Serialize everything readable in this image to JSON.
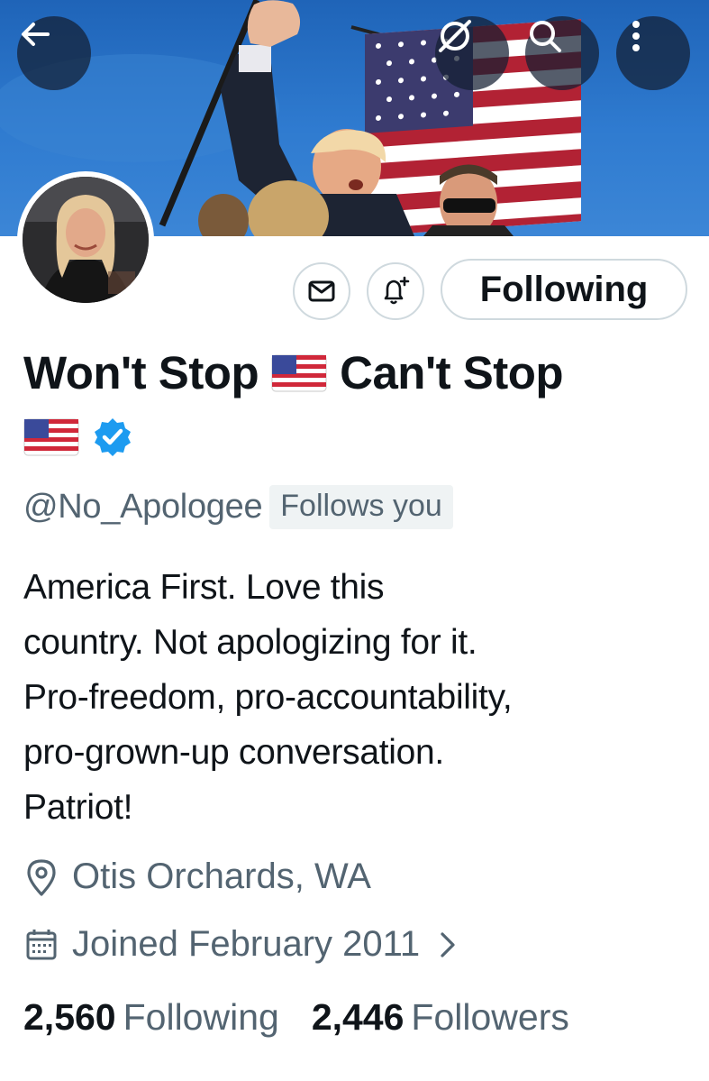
{
  "profile": {
    "name_part1": "Won't Stop",
    "name_part2": "Can't Stop",
    "name_flag_emoji": "us-flag",
    "verified": true,
    "verified_color": "#1d9bf0",
    "handle": "@No_Apologee",
    "follows_you_label": "Follows you",
    "bio_lines": [
      "America First. Love this",
      "country. Not apologizing for it.",
      "Pro-freedom, pro-accountability,",
      "pro-grown-up conversation.",
      "Patriot!"
    ],
    "location": "Otis Orchards, WA",
    "joined": "Joined February 2011",
    "following_count": "2,560",
    "following_label": "Following",
    "followers_count": "2,446",
    "followers_label": "Followers"
  },
  "actions": {
    "following_button_label": "Following",
    "message_icon": "mail-icon",
    "notify_icon": "bell-plus-icon"
  },
  "top_bar": {
    "back_icon": "back-arrow-icon",
    "grok_icon": "grok-icon",
    "search_icon": "search-icon",
    "more_icon": "more-vertical-icon"
  },
  "colors": {
    "text_primary": "#0f1419",
    "text_secondary": "#536471",
    "border": "#cfd9de",
    "badge_bg": "#eff3f4"
  }
}
